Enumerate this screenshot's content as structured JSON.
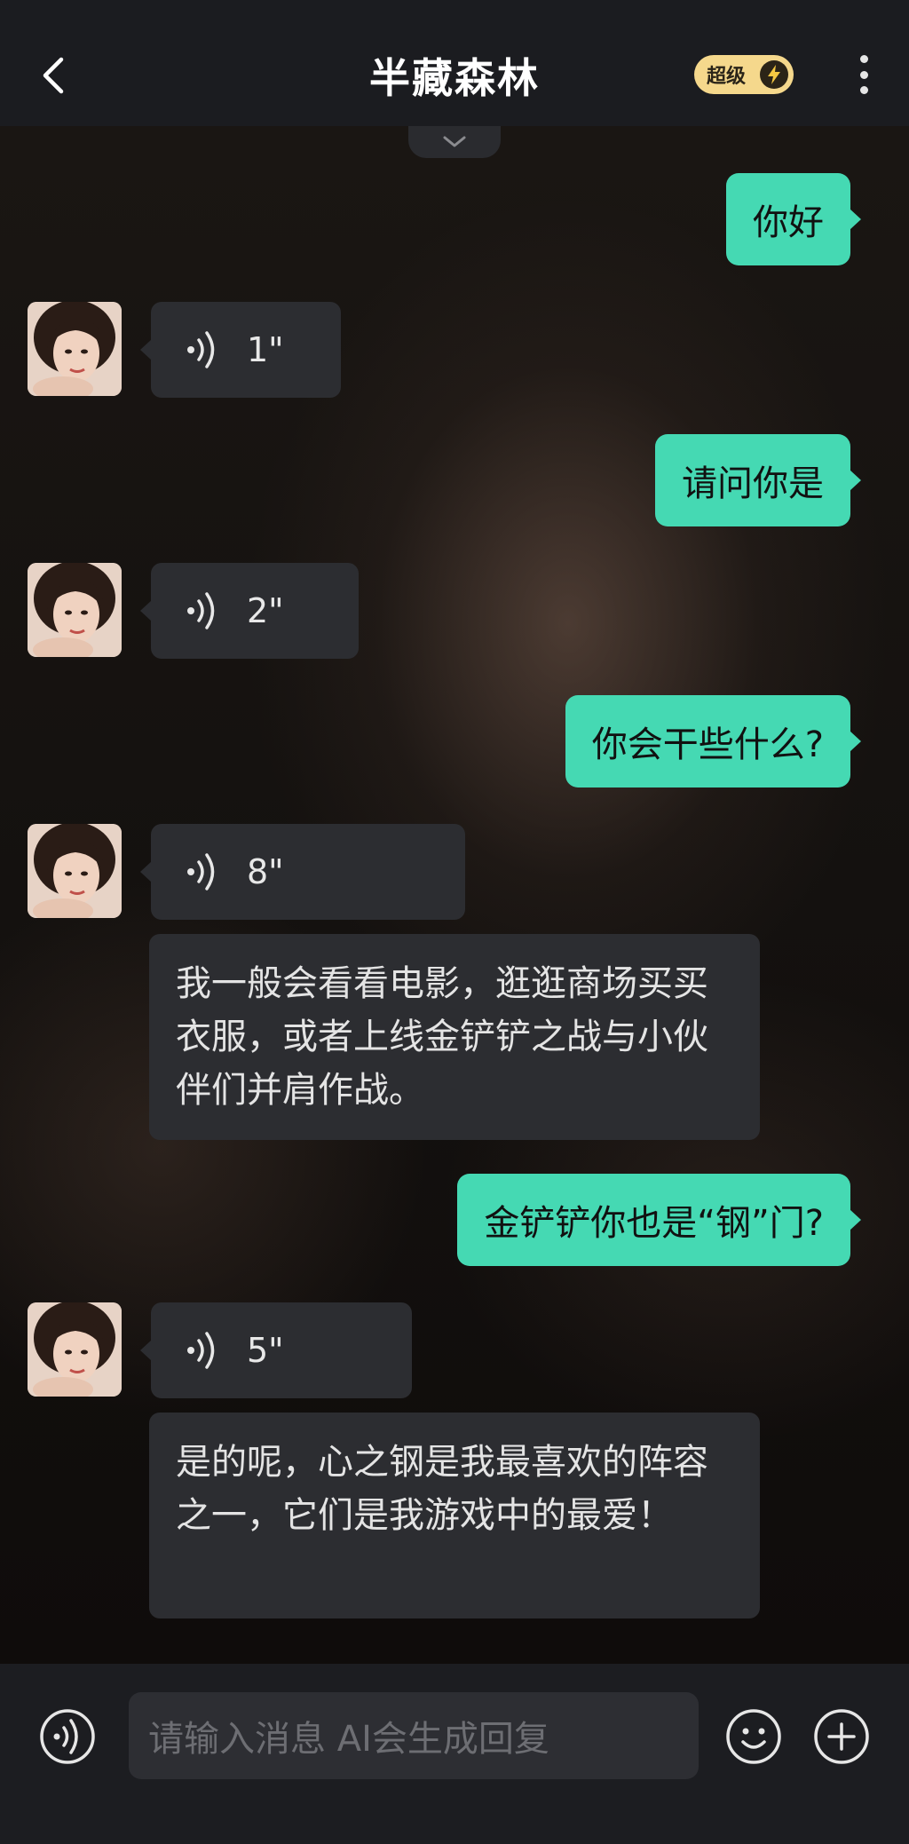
{
  "header": {
    "title": "半藏森林",
    "badge": "超级"
  },
  "messages": [
    {
      "type": "sent",
      "text": "你好"
    },
    {
      "type": "voice",
      "duration": "1\""
    },
    {
      "type": "sent",
      "text": "请问你是"
    },
    {
      "type": "voice",
      "duration": "2\""
    },
    {
      "type": "sent",
      "text": "你会干些什么?"
    },
    {
      "type": "voice",
      "duration": "8\""
    },
    {
      "type": "received",
      "text": "我一般会看看电影，逛逛商场买买衣服，或者上线金铲铲之战与小伙伴们并肩作战。"
    },
    {
      "type": "sent",
      "text": "金铲铲你也是“钢”门?"
    },
    {
      "type": "voice",
      "duration": "5\""
    },
    {
      "type": "received",
      "text": "是的呢，心之钢是我最喜欢的阵容之一，它们是我游戏中的最爱！"
    }
  ],
  "input": {
    "placeholder": "请输入消息 AI会生成回复"
  },
  "colors": {
    "accent": "#45d9b3",
    "badge": "#f5d88c",
    "bubble_dark": "#2c2d31",
    "bar": "#1c1d21"
  }
}
